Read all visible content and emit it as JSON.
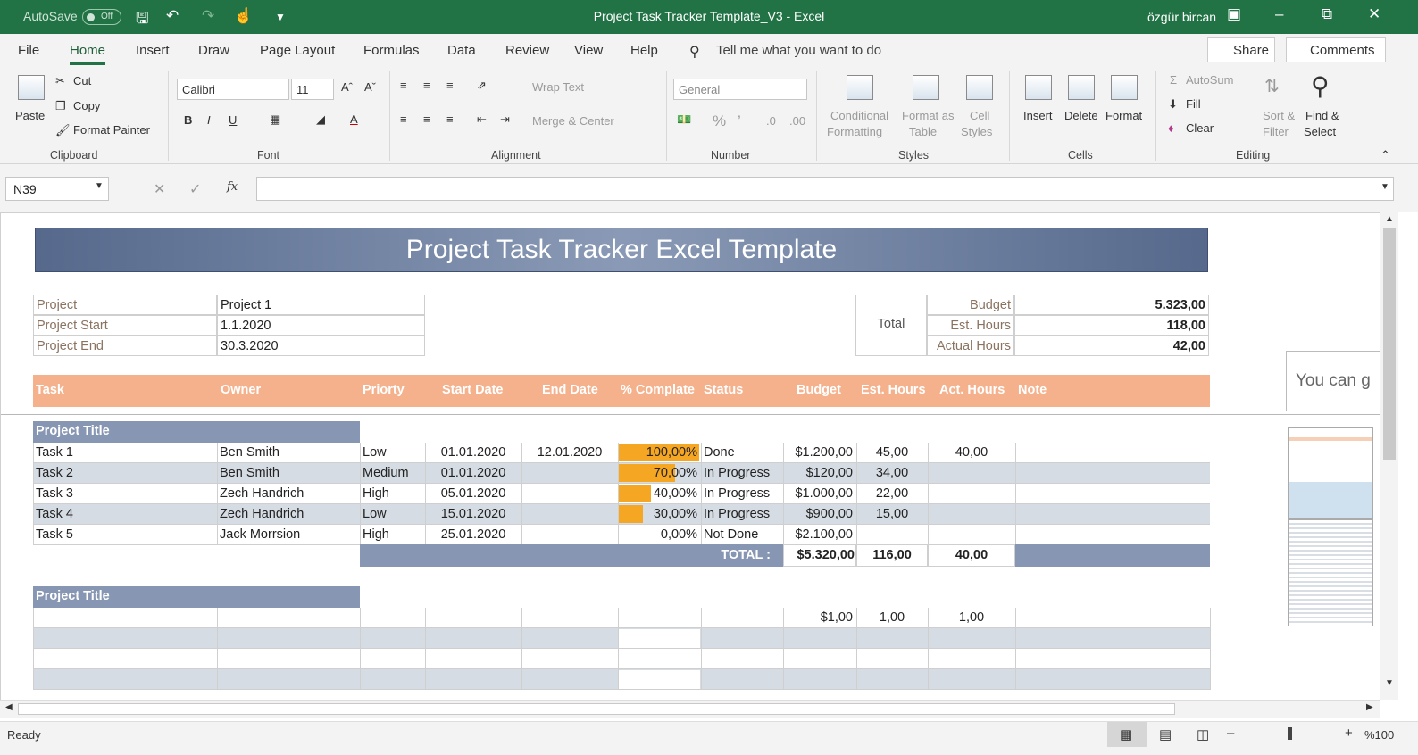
{
  "titlebar": {
    "autosave": "AutoSave",
    "autosave_state": "Off",
    "title": "Project Task Tracker Template_V3  -  Excel",
    "user": "özgür bircan"
  },
  "tabs": [
    "File",
    "Home",
    "Insert",
    "Draw",
    "Page Layout",
    "Formulas",
    "Data",
    "Review",
    "View",
    "Help"
  ],
  "tell_me": "Tell me what you want to do",
  "share": "Share",
  "comments": "Comments",
  "ribbon": {
    "clipboard": {
      "paste": "Paste",
      "cut": "Cut",
      "copy": "Copy",
      "format_painter": "Format Painter",
      "label": "Clipboard"
    },
    "font": {
      "name": "Calibri",
      "size": "11",
      "label": "Font"
    },
    "alignment": {
      "wrap": "Wrap Text",
      "merge": "Merge & Center",
      "label": "Alignment"
    },
    "number": {
      "format": "General",
      "label": "Number"
    },
    "styles": {
      "cond1": "Conditional",
      "cond2": "Formatting",
      "fat1": "Format as",
      "fat2": "Table",
      "cs1": "Cell",
      "cs2": "Styles",
      "label": "Styles"
    },
    "cells": {
      "insert": "Insert",
      "delete": "Delete",
      "format": "Format",
      "label": "Cells"
    },
    "editing": {
      "autosum": "AutoSum",
      "fill": "Fill",
      "clear": "Clear",
      "sort1": "Sort &",
      "sort2": "Filter",
      "find1": "Find &",
      "find2": "Select",
      "label": "Editing"
    }
  },
  "namebox": "N39",
  "sheet": {
    "banner": "Project Task Tracker Excel Template",
    "info": [
      {
        "label": "Project",
        "value": "Project 1"
      },
      {
        "label": "Project Start",
        "value": "1.1.2020"
      },
      {
        "label": "Project End",
        "value": "30.3.2020"
      }
    ],
    "totals": {
      "label": "Total",
      "rows": [
        {
          "label": "Budget",
          "value": "5.323,00"
        },
        {
          "label": "Est. Hours",
          "value": "118,00"
        },
        {
          "label": "Actual Hours",
          "value": "42,00"
        }
      ]
    },
    "headers": [
      "Task",
      "Owner",
      "Priorty",
      "Start Date",
      "End Date",
      "% Complate",
      "Status",
      "Budget",
      "Est. Hours",
      "Act. Hours",
      "Note"
    ],
    "section1": "Project Title",
    "tasks": [
      {
        "task": "Task 1",
        "owner": "Ben Smith",
        "priority": "Low",
        "start": "01.01.2020",
        "end": "12.01.2020",
        "pct": "100,00%",
        "pct_value": 1.0,
        "status": "Done",
        "budget": "$1.200,00",
        "est": "45,00",
        "act": "40,00"
      },
      {
        "task": "Task 2",
        "owner": "Ben Smith",
        "priority": "Medium",
        "start": "01.01.2020",
        "end": "",
        "pct": "70,00%",
        "pct_value": 0.7,
        "status": "In Progress",
        "budget": "$120,00",
        "est": "34,00",
        "act": ""
      },
      {
        "task": "Task 3",
        "owner": "Zech Handrich",
        "priority": "High",
        "start": "05.01.2020",
        "end": "",
        "pct": "40,00%",
        "pct_value": 0.4,
        "status": "In Progress",
        "budget": "$1.000,00",
        "est": "22,00",
        "act": ""
      },
      {
        "task": "Task 4",
        "owner": "Zech Handrich",
        "priority": "Low",
        "start": "15.01.2020",
        "end": "",
        "pct": "30,00%",
        "pct_value": 0.3,
        "status": "In Progress",
        "budget": "$900,00",
        "est": "15,00",
        "act": ""
      },
      {
        "task": "Task 5",
        "owner": "Jack Morrsion",
        "priority": "High",
        "start": "25.01.2020",
        "end": "",
        "pct": "0,00%",
        "pct_value": 0,
        "status": "Not Done",
        "budget": "$2.100,00",
        "est": "",
        "act": ""
      }
    ],
    "total": {
      "label": "TOTAL :",
      "budget": "$5.320,00",
      "est": "116,00",
      "act": "40,00"
    },
    "section2": "Project Title",
    "section2_row": {
      "budget": "$1,00",
      "est": "1,00",
      "act": "1,00"
    },
    "side_text": "You can g"
  },
  "status": {
    "ready": "Ready",
    "zoom": "%100"
  },
  "colors": {
    "excel_green": "#217346",
    "header_orange": "#f4b18c",
    "progress": "#f5a623",
    "section": "#8796b2"
  }
}
